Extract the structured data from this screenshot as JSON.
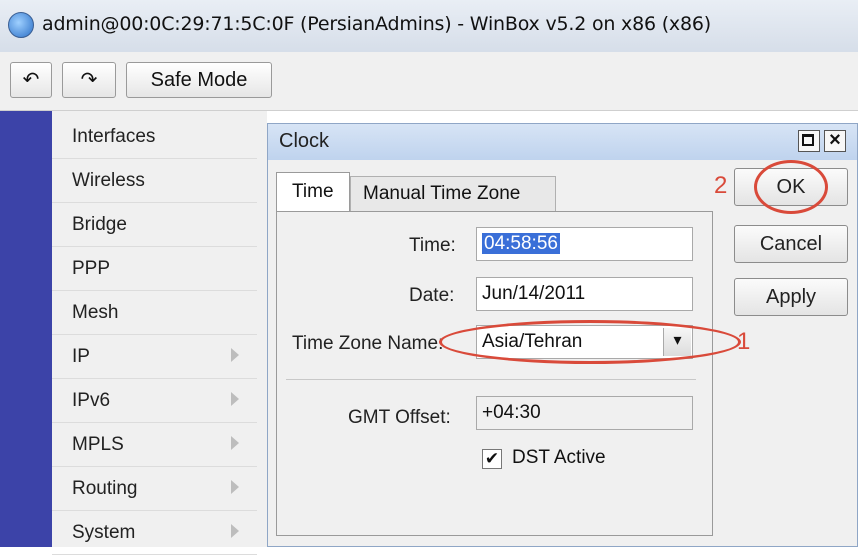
{
  "window": {
    "title": "admin@00:0C:29:71:5C:0F (PersianAdmins) - WinBox v5.2 on x86 (x86)"
  },
  "toolbar": {
    "undo_icon": "↶",
    "redo_icon": "↷",
    "safe_mode_label": "Safe Mode"
  },
  "sidebar": {
    "items": [
      {
        "label": "Interfaces",
        "has_submenu": false
      },
      {
        "label": "Wireless",
        "has_submenu": false
      },
      {
        "label": "Bridge",
        "has_submenu": false
      },
      {
        "label": "PPP",
        "has_submenu": false
      },
      {
        "label": "Mesh",
        "has_submenu": false
      },
      {
        "label": "IP",
        "has_submenu": true
      },
      {
        "label": "IPv6",
        "has_submenu": true
      },
      {
        "label": "MPLS",
        "has_submenu": true
      },
      {
        "label": "Routing",
        "has_submenu": true
      },
      {
        "label": "System",
        "has_submenu": true
      }
    ]
  },
  "dialog": {
    "title": "Clock",
    "close_symbol": "×",
    "tabs": [
      {
        "label": "Time",
        "active": true
      },
      {
        "label": "Manual Time Zone",
        "active": false
      }
    ],
    "fields": {
      "time_label": "Time:",
      "time_value": "04:58:56",
      "date_label": "Date:",
      "date_value": "Jun/14/2011",
      "tz_label": "Time Zone Name:",
      "tz_value": "Asia/Tehran",
      "tz_dropdown_icon": "▾",
      "gmt_label": "GMT Offset:",
      "gmt_value": "+04:30",
      "dst_label": "DST Active",
      "dst_checked": true,
      "dst_check_mark": "✔"
    },
    "buttons": {
      "ok": "OK",
      "cancel": "Cancel",
      "apply": "Apply"
    }
  },
  "annotations": {
    "step1": "1",
    "step2": "2",
    "color": "#d94a3a"
  },
  "colors": {
    "side_strip": "#3c43a8",
    "selection": "#3a6fd8"
  }
}
